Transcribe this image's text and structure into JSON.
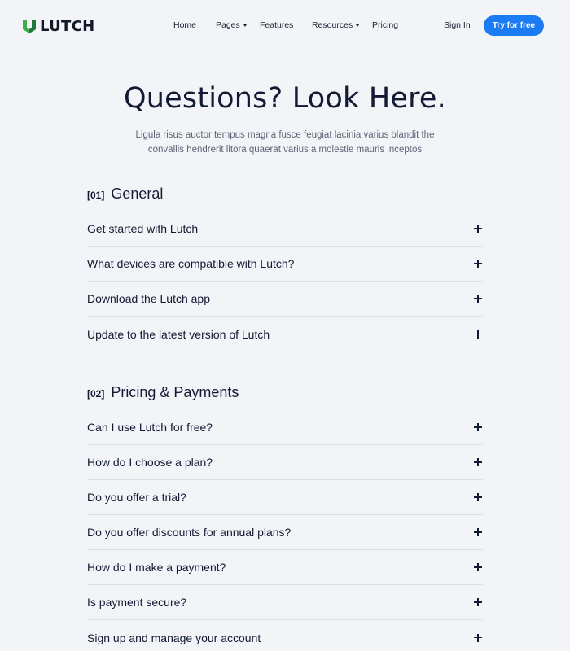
{
  "brand": {
    "name": "LUTCH",
    "logo_icon": "lutch-logo-icon"
  },
  "nav": {
    "items": [
      {
        "label": "Home",
        "dropdown": false
      },
      {
        "label": "Pages",
        "dropdown": true
      },
      {
        "label": "Features",
        "dropdown": false
      },
      {
        "label": "Resources",
        "dropdown": true
      },
      {
        "label": "Pricing",
        "dropdown": false
      }
    ],
    "sign_in": "Sign In",
    "cta": "Try for free"
  },
  "hero": {
    "title": "Questions? Look Here.",
    "subtitle_line1": "Ligula risus auctor tempus magna fusce feugiat lacinia varius blandit the",
    "subtitle_line2": "convallis hendrerit litora quaerat varius a molestie mauris inceptos"
  },
  "sections": [
    {
      "number": "[01]",
      "title": "General",
      "questions": [
        "Get started with Lutch",
        "What devices are compatible with Lutch?",
        "Download the Lutch app",
        "Update to the latest version of Lutch"
      ]
    },
    {
      "number": "[02]",
      "title": "Pricing & Payments",
      "questions": [
        "Can I use Lutch for free?",
        "How do I choose a plan?",
        "Do you offer a trial?",
        "Do you offer discounts for annual plans?",
        "How do I make a payment?",
        "Is payment secure?",
        "Sign up and manage your account"
      ]
    }
  ],
  "colors": {
    "accent": "#1b7cf2",
    "logo_green": "#3fae49",
    "logo_dark": "#1f7a3a",
    "background": "#f3f4f8"
  }
}
